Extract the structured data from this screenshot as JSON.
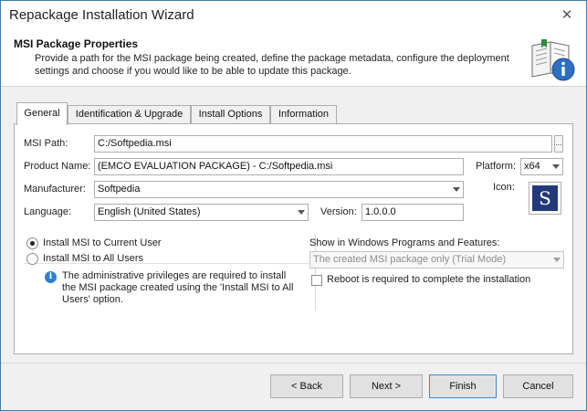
{
  "window": {
    "title": "Repackage Installation Wizard",
    "close_glyph": "✕"
  },
  "header": {
    "title": "MSI Package Properties",
    "description": "Provide a path for the MSI package being created, define the package metadata, configure the deployment settings and choose if you would like to be able to update this package.",
    "icon": "book-info-icon"
  },
  "tabs": [
    {
      "label": "General",
      "active": true
    },
    {
      "label": "Identification & Upgrade",
      "active": false
    },
    {
      "label": "Install Options",
      "active": false
    },
    {
      "label": "Information",
      "active": false
    }
  ],
  "form": {
    "msi_path_label": "MSI Path:",
    "msi_path_value": "C:/Softpedia.msi",
    "msi_path_button": "...",
    "product_name_label": "Product Name:",
    "product_name_value": "(EMCO EVALUATION PACKAGE) - C:/Softpedia.msi",
    "platform_label": "Platform:",
    "platform_value": "x64",
    "manufacturer_label": "Manufacturer:",
    "manufacturer_value": "Softpedia",
    "icon_label": "Icon:",
    "icon_letter": "S",
    "language_label": "Language:",
    "language_value": "English (United States)",
    "version_label": "Version:",
    "version_value": "1.0.0.0"
  },
  "install_scope": {
    "current_user_label": "Install MSI to Current User",
    "current_user_checked": true,
    "all_users_label": "Install MSI to All Users",
    "all_users_checked": false,
    "info_glyph": "i",
    "info_text": "The administrative privileges are required to install the MSI package created using the 'Install MSI to All Users' option."
  },
  "programs_features": {
    "label": "Show in Windows Programs and Features:",
    "value": "The created MSI package only (Trial Mode)",
    "reboot_label": "Reboot is required to complete the installation",
    "reboot_checked": false
  },
  "footer": {
    "back_label": "< Back",
    "next_label": "Next >",
    "finish_label": "Finish",
    "cancel_label": "Cancel"
  },
  "colors": {
    "accent": "#3c7fb1",
    "icon_background": "#223a7a",
    "info_blue": "#2f7fd0"
  }
}
